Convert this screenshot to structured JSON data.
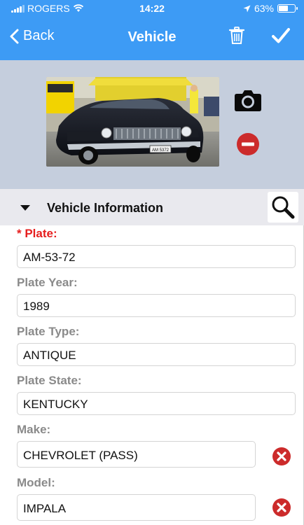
{
  "status": {
    "carrier": "ROGERS",
    "time": "14:22",
    "battery": "63%",
    "battery_level": 0.63
  },
  "nav": {
    "back_label": "Back",
    "title": "Vehicle"
  },
  "section": {
    "title": "Vehicle Information"
  },
  "fields": {
    "plate": {
      "label": "* Plate:",
      "value": "AM-53-72"
    },
    "plate_year": {
      "label": "Plate Year:",
      "value": "1989"
    },
    "plate_type": {
      "label": "Plate Type:",
      "value": "ANTIQUE"
    },
    "plate_state": {
      "label": "Plate State:",
      "value": "KENTUCKY"
    },
    "make": {
      "label": "Make:",
      "value": "CHEVROLET (PASS)"
    },
    "model": {
      "label": "Model:",
      "value": "IMPALA"
    }
  },
  "photo": {
    "plate_text": "AM 5372"
  },
  "colors": {
    "accent": "#3d9bf5",
    "required": "#e61e1e",
    "danger": "#cc2b2b",
    "photo_bg": "#c5cedd",
    "section_bg": "#e9e9ee"
  },
  "icons": [
    "back-chevron-icon",
    "trash-icon",
    "checkmark-icon",
    "camera-icon",
    "remove-icon",
    "caret-down-icon",
    "search-icon",
    "clear-icon"
  ]
}
